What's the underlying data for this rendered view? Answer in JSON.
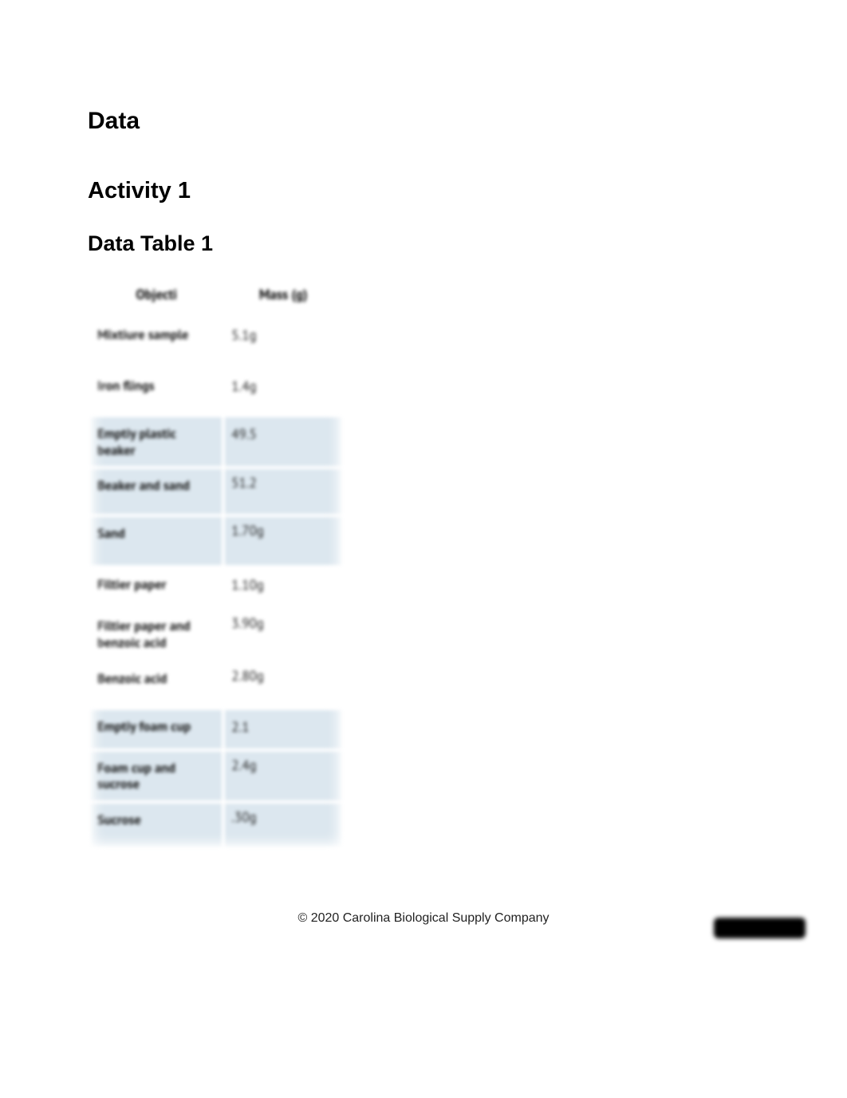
{
  "headings": {
    "data": "Data",
    "activity": "Activity 1",
    "table": "Data Table 1"
  },
  "columns": {
    "object": "Objecti",
    "mass": "Mass (g)"
  },
  "rows": [
    {
      "label": "Mixtiure sample",
      "value": "5.1g",
      "tone": "white",
      "h": "h60"
    },
    {
      "label": "Iron flings",
      "value": "1.4g",
      "tone": "white",
      "h": "h56"
    },
    {
      "label": "Emptiy plastic beaker",
      "value": "49.5",
      "tone": "blue",
      "h": "h56"
    },
    {
      "label": "Beaker and sand",
      "value": "51.2",
      "tone": "blue",
      "h": "h56",
      "valign": "top"
    },
    {
      "label": "Sand",
      "value": "1.70g",
      "tone": "blue",
      "h": "h60",
      "valign": "top"
    },
    {
      "label": "Filtier paper",
      "value": "1.10g",
      "tone": "white",
      "h": "h48"
    },
    {
      "label": "Filtier paper and benzoic acid",
      "value": "3.90g",
      "tone": "white",
      "h": "h54",
      "valign": "top"
    },
    {
      "label": "Benzoic acid",
      "value": "2.80g",
      "tone": "white",
      "h": "h56",
      "valign": "top"
    },
    {
      "label": "Emptiy foam cup",
      "value": "2.1",
      "tone": "blue",
      "h": "h48"
    },
    {
      "label": "Foam cup and sucrose",
      "value": "2.4g",
      "tone": "blue",
      "h": "h54",
      "valign": "top"
    },
    {
      "label": "Sucrose",
      "value": ".30g",
      "tone": "blue",
      "h": "h54",
      "valign": "top"
    }
  ],
  "footer": "© 2020 Carolina Biological Supply Company",
  "chart_data": {
    "type": "table",
    "title": "Data Table 1",
    "columns": [
      "Objecti",
      "Mass (g)"
    ],
    "rows": [
      [
        "Mixtiure sample",
        "5.1g"
      ],
      [
        "Iron flings",
        "1.4g"
      ],
      [
        "Emptiy plastic beaker",
        "49.5"
      ],
      [
        "Beaker and sand",
        "51.2"
      ],
      [
        "Sand",
        "1.70g"
      ],
      [
        "Filtier paper",
        "1.10g"
      ],
      [
        "Filtier paper and benzoic acid",
        "3.90g"
      ],
      [
        "Benzoic acid",
        "2.80g"
      ],
      [
        "Emptiy foam cup",
        "2.1"
      ],
      [
        "Foam cup and sucrose",
        "2.4g"
      ],
      [
        "Sucrose",
        ".30g"
      ]
    ]
  }
}
